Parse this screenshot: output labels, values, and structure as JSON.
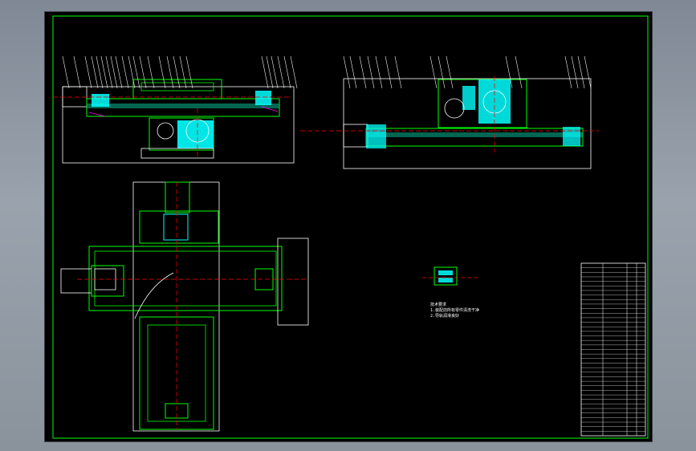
{
  "window": {
    "background_color": "#8e97a1"
  },
  "drawing": {
    "frame_color": "#00ff00",
    "colors": {
      "outline": "#ffffff",
      "part": "#00ff00",
      "section": "#00ffff",
      "centerline": "#ff0000",
      "hatch": "#ff00ff",
      "bolt": "#ffff00"
    },
    "detail_note_lines": [
      "技术要求",
      "1.装配前所有零件清洗干净",
      "2.导轨润滑良好"
    ],
    "title_block": {
      "rows": 38
    }
  }
}
